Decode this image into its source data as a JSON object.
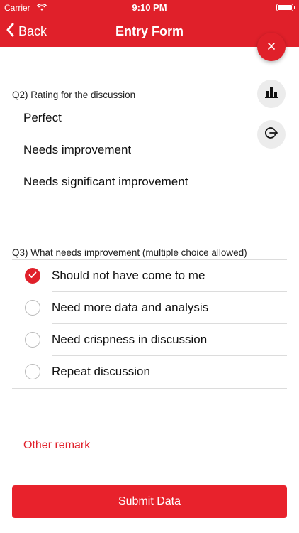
{
  "status_bar": {
    "carrier": "Carrier",
    "time": "9:10 PM"
  },
  "nav": {
    "back_label": "Back",
    "title": "Entry Form"
  },
  "q2": {
    "label": "Q2) Rating for the discussion",
    "options": [
      "Perfect",
      "Needs improvement",
      "Needs significant improvement"
    ]
  },
  "q3": {
    "label": "Q3) What needs improvement (multiple choice allowed)",
    "options": [
      {
        "label": "Should not have come to me",
        "checked": true
      },
      {
        "label": "Need more data and analysis",
        "checked": false
      },
      {
        "label": "Need crispness in discussion",
        "checked": false
      },
      {
        "label": "Repeat discussion",
        "checked": false
      }
    ]
  },
  "remark": {
    "placeholder": "Other remark"
  },
  "submit": {
    "label": "Submit Data"
  },
  "colors": {
    "accent": "#e0202a"
  },
  "icons": {
    "close": "close-icon",
    "chart": "bar-chart-icon",
    "exit": "exit-icon",
    "back": "chevron-left-icon",
    "check": "checkmark-icon"
  }
}
